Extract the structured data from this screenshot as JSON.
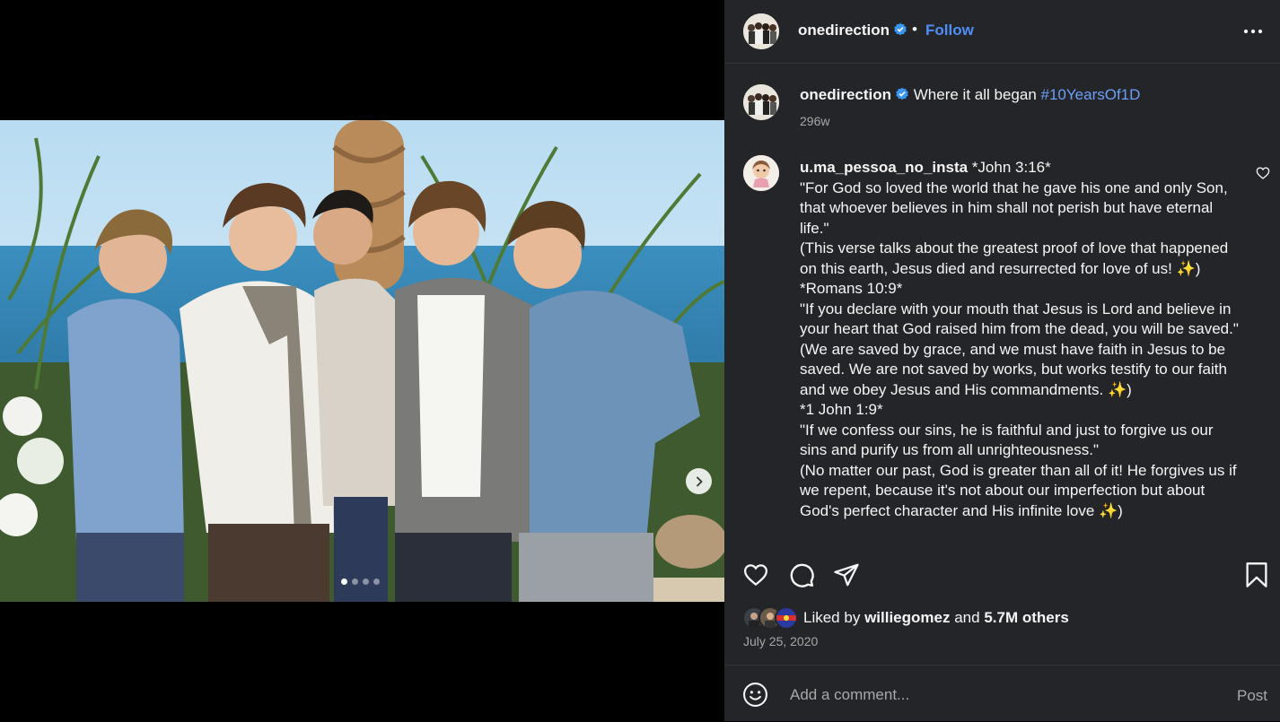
{
  "post": {
    "username": "onedirection",
    "dot": "•",
    "follow_label": "Follow"
  },
  "caption": {
    "username": "onedirection",
    "text": "Where it all began",
    "hashtag": "#10YearsOf1D",
    "time": "296w"
  },
  "comment": {
    "username": "u.ma_pessoa_no_insta",
    "first_line": "*John 3:16*",
    "body": "\"For God so loved the world that he gave his one and only Son, that whoever believes in him shall not perish but have eternal life.\"\n(This verse talks about the greatest proof of love that happened on this earth, Jesus died and resurrected for love of us! ✨)\n*Romans 10:9*\n\"If you declare with your mouth that Jesus is Lord and believe in your heart that God raised him from the dead, you will be saved.\"\n(We are saved by grace, and we must have faith in Jesus to be saved. We are not saved by works, but works testify to our faith and we obey Jesus and His commandments. ✨)\n*1 John 1:9*\n\"If we confess our sins, he is faithful and just to forgive us our sins and purify us from all unrighteousness.\"\n(No matter our past, God is greater than all of it! He forgives us if we repent, because it's not about our imperfection but about God's perfect character and His infinite love ✨)"
  },
  "likes": {
    "prefix": "Liked by",
    "user": "williegomez",
    "and": "and",
    "others": "5.7M others"
  },
  "date": "July 25, 2020",
  "comment_input": {
    "placeholder": "Add a comment...",
    "post_label": "Post"
  },
  "carousel": {
    "count": 4,
    "active_index": 0
  },
  "colors": {
    "panel_bg": "#242528",
    "link_blue": "#4f8ef7",
    "hashtag_blue": "#6c9ff8",
    "verified_blue": "#3897f0",
    "muted": "#a8a8a8"
  }
}
